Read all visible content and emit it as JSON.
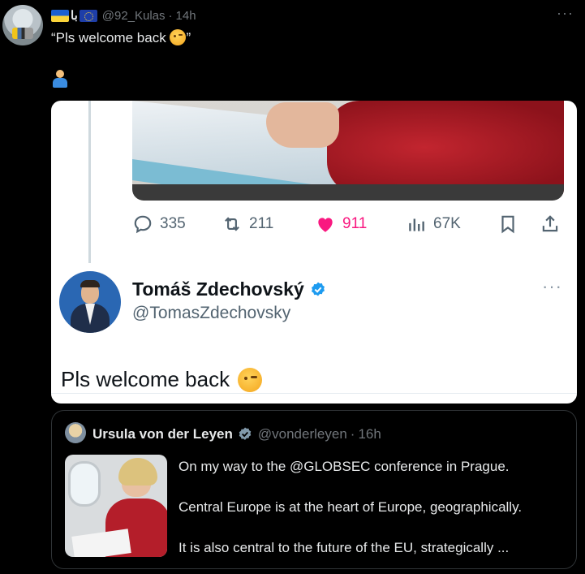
{
  "post": {
    "author_handle": "@92_Kulas",
    "arabic_text": "با",
    "timestamp": "14h",
    "text": "“Pls welcome back ",
    "text_end": "”",
    "more_label": "···"
  },
  "screenshot": {
    "counts": {
      "replies": "335",
      "reposts": "211",
      "likes": "911",
      "views": "67K"
    },
    "profile": {
      "name": "Tomáš Zdechovský",
      "handle": "@TomasZdechovsky",
      "more_label": "···"
    },
    "text": "Pls welcome back"
  },
  "quote": {
    "name": "Ursula von der Leyen",
    "handle": "@vonderleyen",
    "separator": "·",
    "timestamp": "16h",
    "lines": [
      "On my way to the @GLOBSEC conference in Prague.",
      "Central Europe is at the heart of Europe, geographically.",
      "It is also central to the future of the EU, strategically ..."
    ]
  },
  "colors": {
    "like_pink": "#f91880",
    "verified_blue": "#1d9bf0",
    "muted_gray": "#71767b"
  }
}
